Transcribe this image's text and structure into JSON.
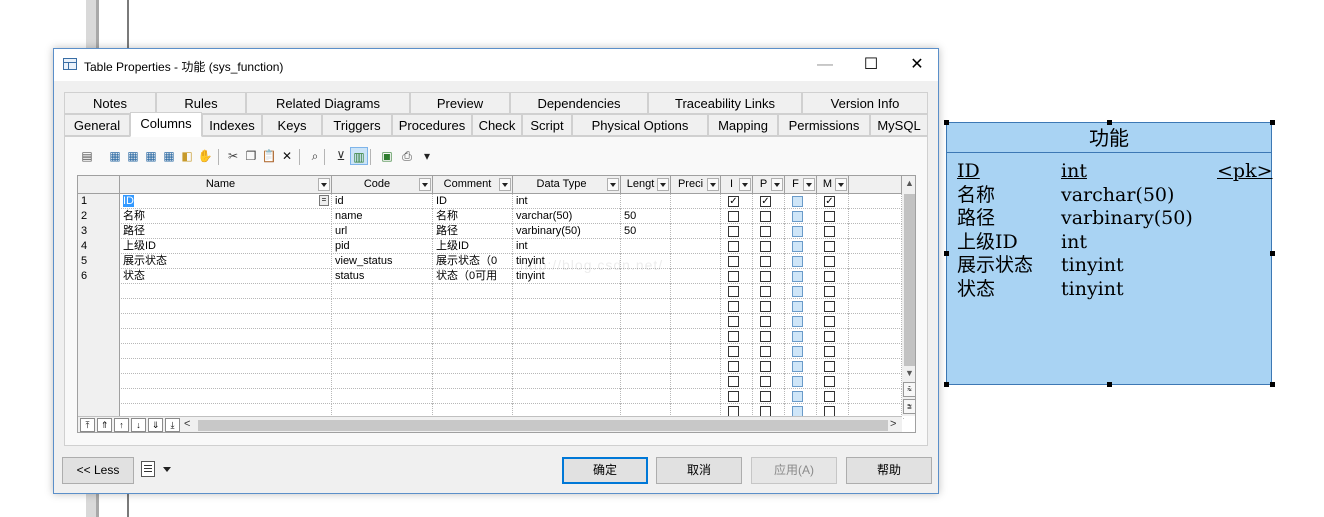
{
  "window": {
    "title": "Table Properties - 功能 (sys_function)",
    "minimize": "—",
    "maximize": "☐",
    "close": "✕"
  },
  "tabs_row1": [
    "Notes",
    "Rules",
    "Related Diagrams",
    "Preview",
    "Dependencies",
    "Traceability Links",
    "Version Info"
  ],
  "tabs_row2": [
    "General",
    "Columns",
    "Indexes",
    "Keys",
    "Triggers",
    "Procedures",
    "Check",
    "Script",
    "Physical Options",
    "Mapping",
    "Permissions",
    "MySQL"
  ],
  "active_tab": "Columns",
  "toolbar_icons": [
    "properties-icon",
    "insert-row-icon",
    "add-row-icon",
    "add-columns-icon",
    "reuse-columns-icon",
    "domain-icon",
    "enable-icon",
    "cut-icon",
    "copy-icon",
    "paste-icon",
    "delete-icon",
    "find-icon",
    "filter-icon",
    "customize-columns-icon",
    "excel-icon",
    "print-icon",
    "dropdown-arrow-icon"
  ],
  "grid": {
    "headers": [
      "Name",
      "Code",
      "Comment",
      "Data Type",
      "Lengt",
      "Preci",
      "I",
      "P",
      "F",
      "M"
    ],
    "rows": [
      {
        "num": "1",
        "name": "ID",
        "code": "id",
        "comment": "ID",
        "type": "int",
        "length": "",
        "i": true,
        "p": true,
        "f": false,
        "m": true
      },
      {
        "num": "2",
        "name": "名称",
        "code": "name",
        "comment": "名称",
        "type": "varchar(50)",
        "length": "50",
        "i": false,
        "p": false,
        "f": false,
        "m": false
      },
      {
        "num": "3",
        "name": "路径",
        "code": "url",
        "comment": "路径",
        "type": "varbinary(50)",
        "length": "50",
        "i": false,
        "p": false,
        "f": false,
        "m": false
      },
      {
        "num": "4",
        "name": "上级ID",
        "code": "pid",
        "comment": "上级ID",
        "type": "int",
        "length": "",
        "i": false,
        "p": false,
        "f": false,
        "m": false
      },
      {
        "num": "5",
        "name": "展示状态",
        "code": "view_status",
        "comment": "展示状态（0",
        "type": "tinyint",
        "length": "",
        "i": false,
        "p": false,
        "f": false,
        "m": false
      },
      {
        "num": "6",
        "name": "状态",
        "code": "status",
        "comment": "状态（0可用",
        "type": "tinyint",
        "length": "",
        "i": false,
        "p": false,
        "f": false,
        "m": false
      }
    ],
    "empty_rows": 9,
    "check_mark": "✓",
    "ellipsis": "="
  },
  "nav_buttons": [
    "⤒",
    "⇑",
    "↑",
    "↓",
    "⇓",
    "⤓"
  ],
  "buttons": {
    "less": "<< Less",
    "ok": "确定",
    "cancel": "取消",
    "apply": "应用(A)",
    "help": "帮助"
  },
  "entity": {
    "title": "功能",
    "pk_label": "<pk>",
    "columns": [
      {
        "name": "ID",
        "type": "int"
      },
      {
        "name": "名称",
        "type": "varchar(50)"
      },
      {
        "name": "路径",
        "type": "varbinary(50)"
      },
      {
        "name": "上级ID",
        "type": "int"
      },
      {
        "name": "展示状态",
        "type": "tinyint"
      },
      {
        "name": "状态",
        "type": "tinyint"
      }
    ]
  },
  "watermark": "http://blog.csdn.net/"
}
